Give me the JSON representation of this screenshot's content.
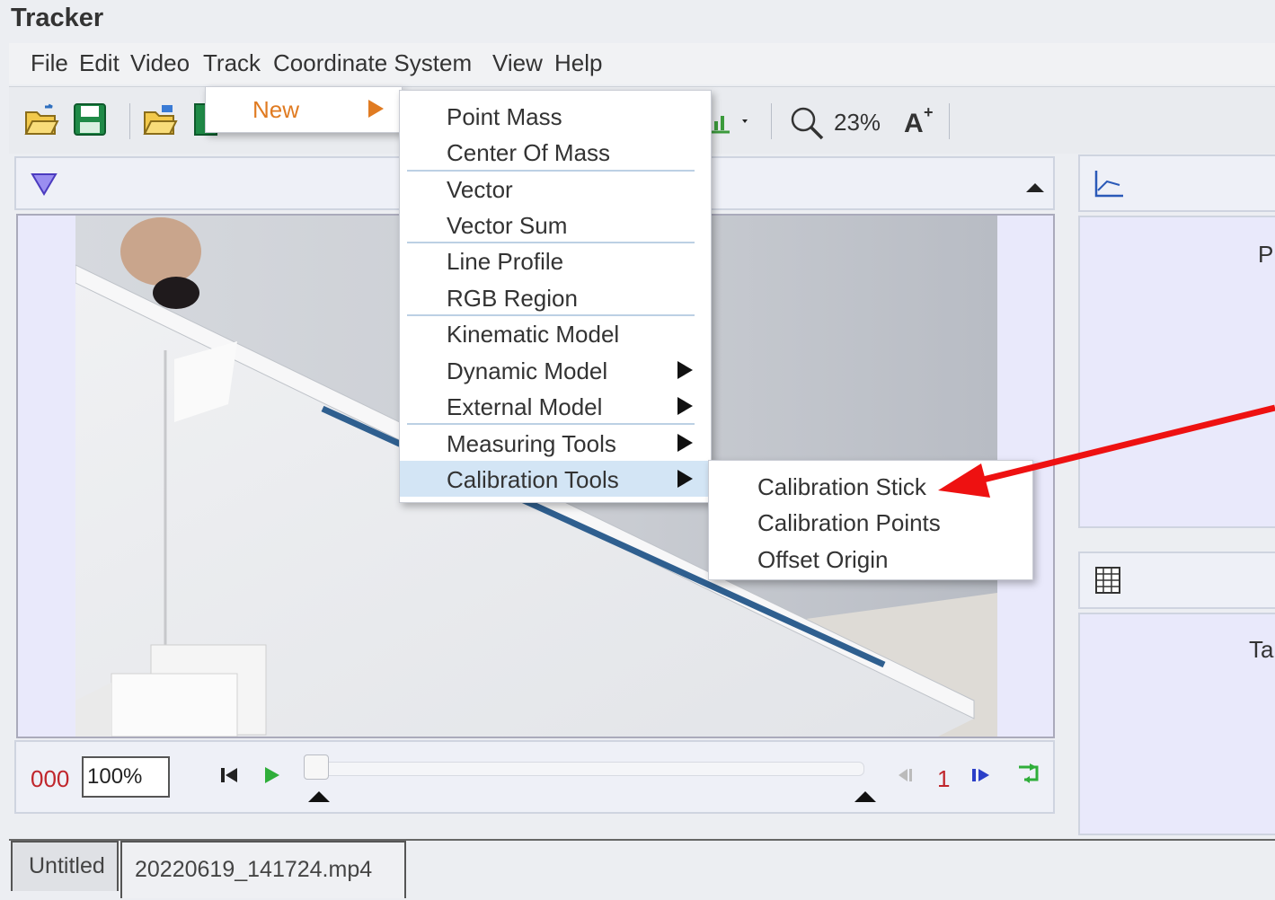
{
  "window": {
    "title": "Tracker"
  },
  "menubar": {
    "items": [
      "File",
      "Edit",
      "Video",
      "Track",
      "Coordinate System",
      "View",
      "Help"
    ]
  },
  "toolbar": {
    "zoom": "23%"
  },
  "track_menu": {
    "new_label": "New"
  },
  "new_submenu": {
    "items": [
      {
        "label": "Point Mass"
      },
      {
        "label": "Center Of Mass"
      },
      {
        "label": "Vector"
      },
      {
        "label": "Vector Sum"
      },
      {
        "label": "Line Profile"
      },
      {
        "label": "RGB Region"
      },
      {
        "label": "Kinematic Model"
      },
      {
        "label": "Dynamic Model"
      },
      {
        "label": "External Model"
      },
      {
        "label": "Measuring Tools"
      },
      {
        "label": "Calibration Tools"
      }
    ]
  },
  "calibration_submenu": {
    "items": [
      {
        "label": "Calibration Stick"
      },
      {
        "label": "Calibration Points"
      },
      {
        "label": "Offset Origin"
      }
    ]
  },
  "player": {
    "frame_number": "000",
    "rate": "100%",
    "step_size": "1"
  },
  "right_panels": {
    "plot_text": "P",
    "table_text": "Ta"
  },
  "tabs": [
    "Untitled",
    "20220619_141724.mp4"
  ],
  "colors": {
    "annotation_arrow": "#ee1111",
    "highlight": "#d3e5f5",
    "frame_text": "#c0262c",
    "new_text": "#e07b22"
  }
}
